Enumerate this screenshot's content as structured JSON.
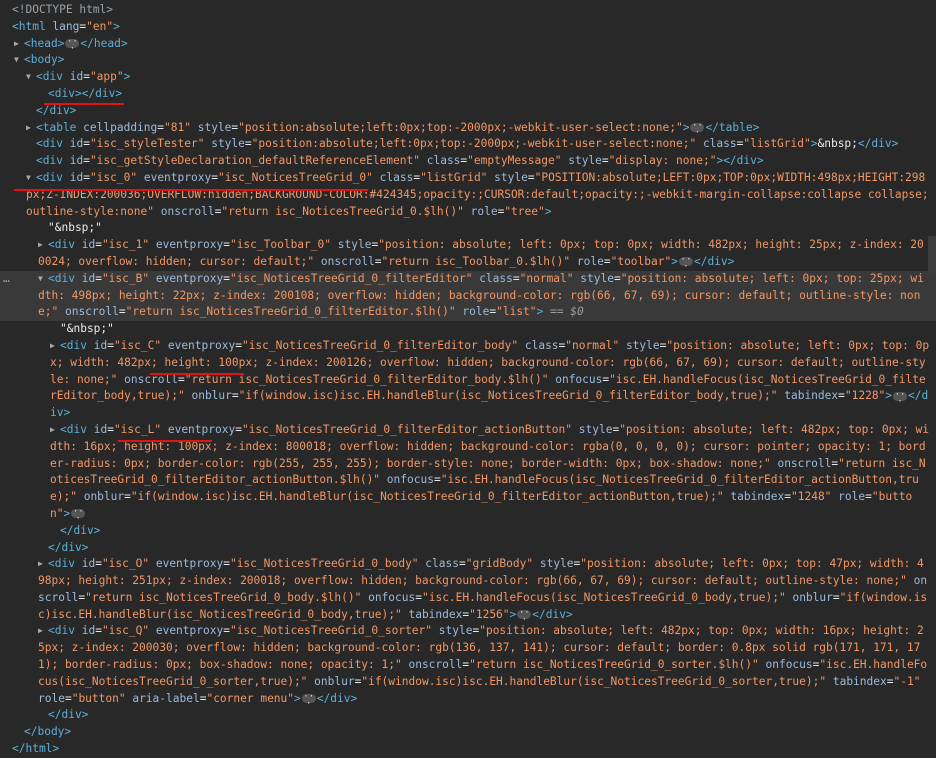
{
  "lines": {
    "l0": {
      "doctype": "<!DOCTYPE html>"
    },
    "l1": {
      "open": "<html",
      "a1": "lang",
      "v1": "\"en\"",
      "close": ">"
    },
    "l2": {
      "open": "<head>",
      "close": "</head>"
    },
    "l3": {
      "open": "<body>"
    },
    "l4": {
      "open": "<div",
      "a1": "id",
      "v1": "\"app\"",
      "close": ">"
    },
    "l5": {
      "tag": "<div></div>"
    },
    "l6": {
      "tag": "</div>"
    },
    "l7": {
      "open": "<table",
      "a1": "cellpadding",
      "v1": "\"81\"",
      "a2": "style",
      "v2": "\"position:absolute;left:0px;top:-2000px;-webkit-user-select:none;\"",
      "gt": ">",
      "close": "</table>"
    },
    "l8": {
      "open": "<div",
      "a1": "id",
      "v1": "\"isc_styleTester\"",
      "a2": "style",
      "v2": "\"position:absolute;left:0px;top:-2000px;-webkit-user-select:none;\"",
      "a3": "class",
      "v3": "\"listGrid\"",
      "gt": ">",
      "text": "&nbsp;",
      "close": "</div>"
    },
    "l9": {
      "open": "<div",
      "a1": "id",
      "v1": "\"isc_getStyleDeclaration_defaultReferenceElement\"",
      "a2": "class",
      "v2": "\"emptyMessage\"",
      "a3": "style",
      "v3": "\"display: none;\"",
      "gt": ">",
      "close": "</div>"
    },
    "l10": {
      "open": "<div",
      "a1": "id",
      "v1": "\"isc_0\"",
      "a2": "eventproxy",
      "v2": "\"isc_NoticesTreeGrid_0\"",
      "a3": "class",
      "v3": "\"listGrid\"",
      "a4": "style",
      "v4": "\"POSITION:absolute;LEFT:0px;TOP:0px;WIDTH:498px;HEIGHT:298px;Z-INDEX:200036;OVERFLOW:hidden;BACKGROUND-COLOR:#424345;opacity:;CURSOR:default;opacity:;-webkit-margin-collapse:collapse collapse;outline-style:none\"",
      "a5": "onscroll",
      "v5": "\"return isc_NoticesTreeGrid_0.$lh()\"",
      "a6": "role",
      "v6": "\"tree\"",
      "close": ">"
    },
    "l11": {
      "text": "\"&nbsp;\""
    },
    "l12": {
      "open": "<div",
      "a1": "id",
      "v1": "\"isc_1\"",
      "a2": "eventproxy",
      "v2": "\"isc_Toolbar_0\"",
      "a3": "style",
      "v3": "\"position: absolute; left: 0px; top: 0px; width: 482px; height: 25px; z-index: 200024; overflow: hidden; cursor: default;\"",
      "a4": "onscroll",
      "v4": "\"return isc_Toolbar_0.$lh()\"",
      "a5": "role",
      "v5": "\"toolbar\"",
      "gt": ">",
      "close": "</div>"
    },
    "l13": {
      "dots": "…",
      "open": "<div",
      "a1": "id",
      "v1": "\"isc_B\"",
      "a2": "eventproxy",
      "v2": "\"isc_NoticesTreeGrid_0_filterEditor\"",
      "a3": "class",
      "v3": "\"normal\"",
      "a4": "style",
      "v4": "\"position: absolute; left: 0px; top: 25px; width: 498px; height: 22px; z-index: 200108; overflow: hidden; background-color: rgb(66, 67, 69); cursor: default; outline-style: none;\"",
      "a5": "onscroll",
      "v5": "\"return isc_NoticesTreeGrid_0_filterEditor.$lh()\"",
      "a6": "role",
      "v6": "\"list\"",
      "close": ">",
      "eq": "== ",
      "dollar": "$0"
    },
    "l14": {
      "text": "\"&nbsp;\""
    },
    "l15": {
      "open": "<div",
      "a1": "id",
      "v1": "\"isc_C\"",
      "a2": "eventproxy",
      "v2": "\"isc_NoticesTreeGrid_0_filterEditor_body\"",
      "a3": "class",
      "v3": "\"normal\"",
      "a4": "style",
      "v4a": "\"position: absolute; left: 0px; top: 0px; width: 482px; ",
      "v4b": "height: 100px",
      "v4c": "; z-index: 200126; overflow: hidden; background-color: rgb(66, 67, 69); cursor: default; outline-style: none;\"",
      "a5": "onscroll",
      "v5": "\"return isc_NoticesTreeGrid_0_filterEditor_body.$lh()\"",
      "a6": "onfocus",
      "v6": "\"isc.EH.handleFocus(isc_NoticesTreeGrid_0_filterEditor_body,true);\"",
      "a7": "onblur",
      "v7": "\"if(window.isc)isc.EH.handleBlur(isc_NoticesTreeGrid_0_filterEditor_body,true);\"",
      "a8": "tabindex",
      "v8": "\"1228\"",
      "gt": ">",
      "close": "</div>"
    },
    "l16": {
      "open": "<div",
      "a1": "id",
      "v1": "\"isc_L\"",
      "a2": "eventproxy",
      "v2": "\"isc_NoticesTreeGrid_0_filterEditor_actionButton\"",
      "a3": "style",
      "v3a": "\"position: absolute; left: 482px; top: 0px; width: 16px; ",
      "v3b": "height: 100px",
      "v3c": "; z-index: 800018; overflow: hidden; background-color: rgba(0, 0, 0, 0); cursor: pointer; opacity: 1; border-radius: 0px; border-color: rgb(255, 255, 255); border-style: none; border-width: 0px; box-shadow: none;\"",
      "a4": "onscroll",
      "v4": "\"return isc_NoticesTreeGrid_0_filterEditor_actionButton.$lh()\"",
      "a5": "onfocus",
      "v5": "\"isc.EH.handleFocus(isc_NoticesTreeGrid_0_filterEditor_actionButton,true);\"",
      "a6": "onblur",
      "v6": "\"if(window.isc)isc.EH.handleBlur(isc_NoticesTreeGrid_0_filterEditor_actionButton,true);\"",
      "a7": "tabindex",
      "v7": "\"1248\"",
      "a8": "role",
      "v8": "\"button\"",
      "gt": ">"
    },
    "l17": {
      "tag": "</div>"
    },
    "l18": {
      "tag": "</div>"
    },
    "l19": {
      "open": "<div",
      "a1": "id",
      "v1": "\"isc_O\"",
      "a2": "eventproxy",
      "v2": "\"isc_NoticesTreeGrid_0_body\"",
      "a3": "class",
      "v3": "\"gridBody\"",
      "a4": "style",
      "v4": "\"position: absolute; left: 0px; top: 47px; width: 498px; height: 251px; z-index: 200018; overflow: hidden; background-color: rgb(66, 67, 69); cursor: default; outline-style: none;\"",
      "a5": "onscroll",
      "v5": "\"return isc_NoticesTreeGrid_0_body.$lh()\"",
      "a6": "onfocus",
      "v6": "\"isc.EH.handleFocus(isc_NoticesTreeGrid_0_body,true);\"",
      "a7": "onblur",
      "v7": "\"if(window.isc)isc.EH.handleBlur(isc_NoticesTreeGrid_0_body,true);\"",
      "a8": "tabindex",
      "v8": "\"1256\"",
      "gt": ">",
      "close": "</div>"
    },
    "l20": {
      "open": "<div",
      "a1": "id",
      "v1": "\"isc_Q\"",
      "a2": "eventproxy",
      "v2": "\"isc_NoticesTreeGrid_0_sorter\"",
      "a3": "style",
      "v3": "\"position: absolute; left: 482px; top: 0px; width: 16px; height: 25px; z-index: 200030; overflow: hidden; background-color: rgb(136, 137, 141); cursor: default; border: 0.8px solid rgb(171, 171, 171); border-radius: 0px; box-shadow: none; opacity: 1;\"",
      "a4": "onscroll",
      "v4": "\"return isc_NoticesTreeGrid_0_sorter.$lh()\"",
      "a5": "onfocus",
      "v5": "\"isc.EH.handleFocus(isc_NoticesTreeGrid_0_sorter,true);\"",
      "a6": "onblur",
      "v6": "\"if(window.isc)isc.EH.handleBlur(isc_NoticesTreeGrid_0_sorter,true);\"",
      "a7": "tabindex",
      "v7": "\"-1\"",
      "a8": "role",
      "v8": "\"button\"",
      "a9": "aria-label",
      "v9": "\"corner menu\"",
      "gt": ">",
      "close": "</div>"
    },
    "l21": {
      "tag": "</div>"
    },
    "l22": {
      "tag": "</body>"
    },
    "l23": {
      "tag": "</html>"
    }
  },
  "colors": {
    "background": "#282828",
    "tag": "#5db0d7",
    "attr_name": "#9bbbdc",
    "attr_value": "#f29766",
    "selected_row": "#393939",
    "underline": "#e01414"
  },
  "icons": {
    "expanded": "triangle-down-icon",
    "collapsed": "triangle-right-icon",
    "ellipsis": "ellipsis-badge-icon"
  }
}
